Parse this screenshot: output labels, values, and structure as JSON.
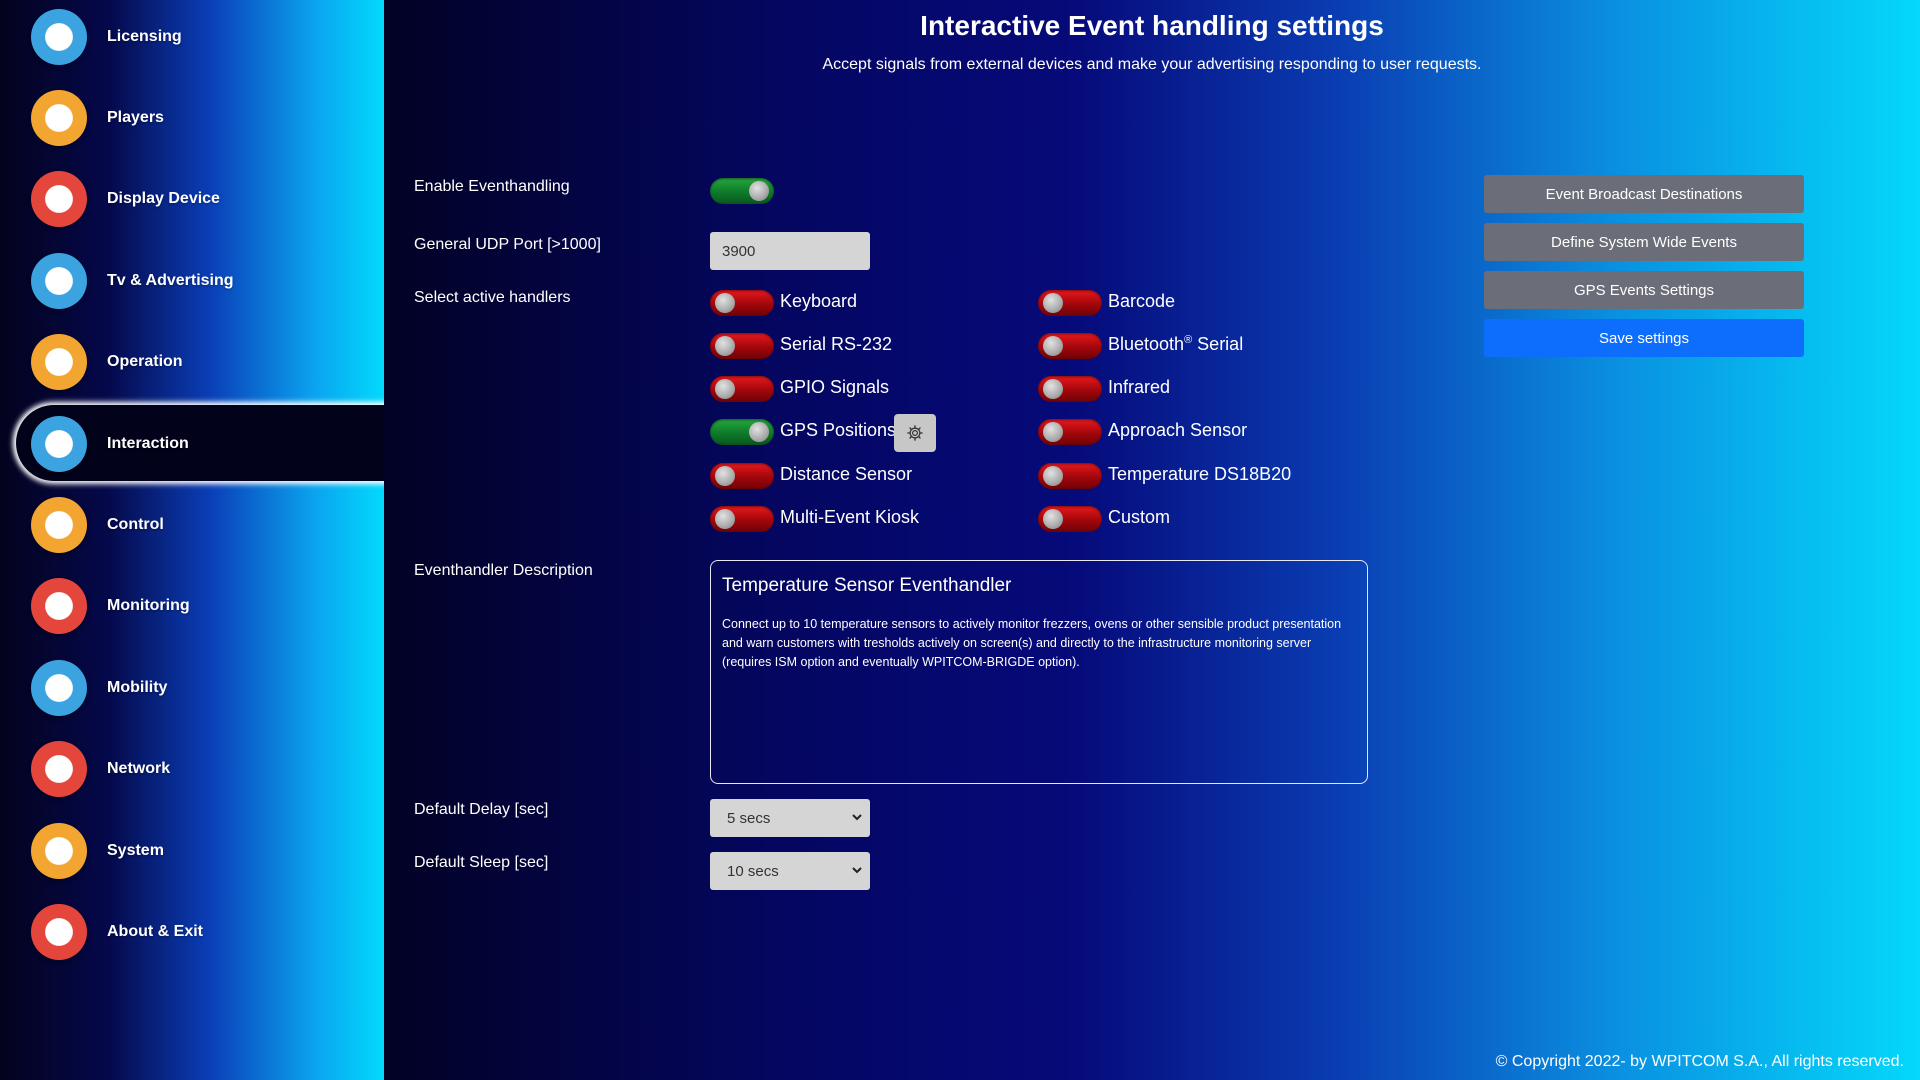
{
  "sidebar": {
    "items": [
      {
        "label": "Licensing",
        "icon": "license-document-icon",
        "color": "#3aa3e0"
      },
      {
        "label": "Players",
        "icon": "players-list-icon",
        "color": "#f3a531"
      },
      {
        "label": "Display Device",
        "icon": "display-device-icon",
        "color": "#e5463c"
      },
      {
        "label": "Tv & Advertising",
        "icon": "tv-advertising-icon",
        "color": "#3aa3e0"
      },
      {
        "label": "Operation",
        "icon": "clock-icon",
        "color": "#f3a531"
      },
      {
        "label": "Interaction",
        "icon": "touch-screen-icon",
        "color": "#3aa3e0"
      },
      {
        "label": "Control",
        "icon": "control-panel-icon",
        "color": "#f3a531"
      },
      {
        "label": "Monitoring",
        "icon": "monitoring-magnifier-icon",
        "color": "#e5463c"
      },
      {
        "label": "Mobility",
        "icon": "globe-network-icon",
        "color": "#3aa3e0"
      },
      {
        "label": "Network",
        "icon": "gear-network-icon",
        "color": "#e5463c"
      },
      {
        "label": "System",
        "icon": "system-login-icon",
        "color": "#f3a531"
      },
      {
        "label": "About & Exit",
        "icon": "power-icon",
        "color": "#e5463c"
      }
    ],
    "active": "Interaction"
  },
  "main": {
    "title": "Interactive Event handling settings",
    "subtitle": "Accept signals from external devices and make your advertising responding to user requests.",
    "enable_label": "Enable Eventhandling",
    "enable_state": true,
    "udp_label": "General UDP Port [>1000]",
    "udp_value": "3900",
    "handlers_label": "Select active handlers",
    "handlers_left": [
      {
        "label": "Keyboard",
        "on": false
      },
      {
        "label": "Serial RS-232",
        "on": false
      },
      {
        "label": "GPIO Signals",
        "on": false
      },
      {
        "label": "GPS Positions",
        "on": true
      },
      {
        "label": "Distance Sensor",
        "on": false
      },
      {
        "label": "Multi-Event Kiosk",
        "on": false
      }
    ],
    "handlers_right": [
      {
        "label": "Barcode",
        "on": false
      },
      {
        "label": "Bluetooth",
        "sup": "®",
        "suffix": " Serial",
        "on": false
      },
      {
        "label": "Infrared",
        "on": false
      },
      {
        "label": "Approach Sensor",
        "on": false
      },
      {
        "label": "Temperature DS18B20",
        "on": false
      },
      {
        "label": "Custom",
        "on": false
      }
    ],
    "desc_label": "Eventhandler Description",
    "desc_title": "Temperature Sensor Eventhandler",
    "desc_text": "Connect up to 10 temperature sensors to actively monitor frezzers, ovens or other sensible product presentation and warn customers with tresholds actively on screen(s) and directly to the infrastructure monitoring server (requires ISM option and eventually WPITCOM-BRIGDE option).",
    "delay_label": "Default Delay [sec]",
    "delay_value": "5 secs",
    "sleep_label": "Default Sleep [sec]",
    "sleep_value": "10 secs",
    "buttons": {
      "broadcast": "Event Broadcast Destinations",
      "system_events": "Define System Wide Events",
      "gps_settings": "GPS Events Settings",
      "save": "Save settings"
    },
    "copyright": "© Copyright 2022- by WPITCOM S.A., All rights reserved."
  },
  "colors": {
    "switch_on": "#0e7a2a",
    "switch_off": "#a2060b",
    "primary_button": "#0d6efd",
    "secondary_button": "#6b6e78"
  }
}
